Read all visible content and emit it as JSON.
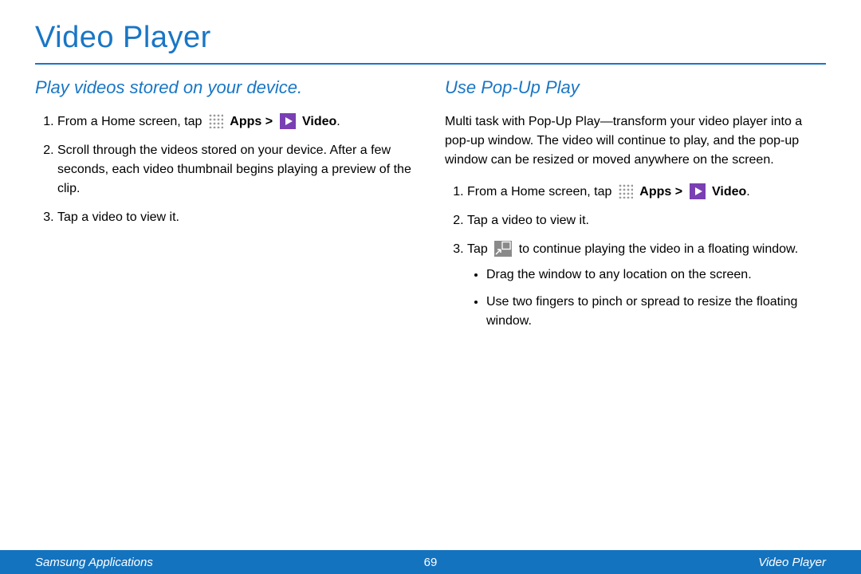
{
  "title": "Video Player",
  "left": {
    "heading": "Play videos stored on your device.",
    "step1_pre": "From a Home screen, tap ",
    "step1_apps": "Apps",
    "step1_gt": " > ",
    "step1_video": "Video",
    "step1_period": ".",
    "step2": "Scroll through the videos stored on your device. After a few seconds, each video thumbnail begins playing a preview of the clip.",
    "step3": "Tap a video to view it."
  },
  "right": {
    "heading": "Use Pop-Up Play",
    "intro": "Multi task with Pop-Up Play—transform your video player into a pop-up window. The video will continue to play, and the pop-up window can be resized or moved anywhere on the screen.",
    "step1_pre": "From a Home screen, tap ",
    "step1_apps": "Apps",
    "step1_gt": " > ",
    "step1_video": "Video",
    "step1_period": ".",
    "step2": "Tap a video to view it.",
    "step3_pre": "Tap ",
    "step3_post": " to continue playing the video in a floating window.",
    "bullet1": "Drag the window to any location on the screen.",
    "bullet2": "Use two fingers to pinch or spread to resize the floating window."
  },
  "footer": {
    "left": "Samsung Applications",
    "center": "69",
    "right": "Video Player"
  }
}
